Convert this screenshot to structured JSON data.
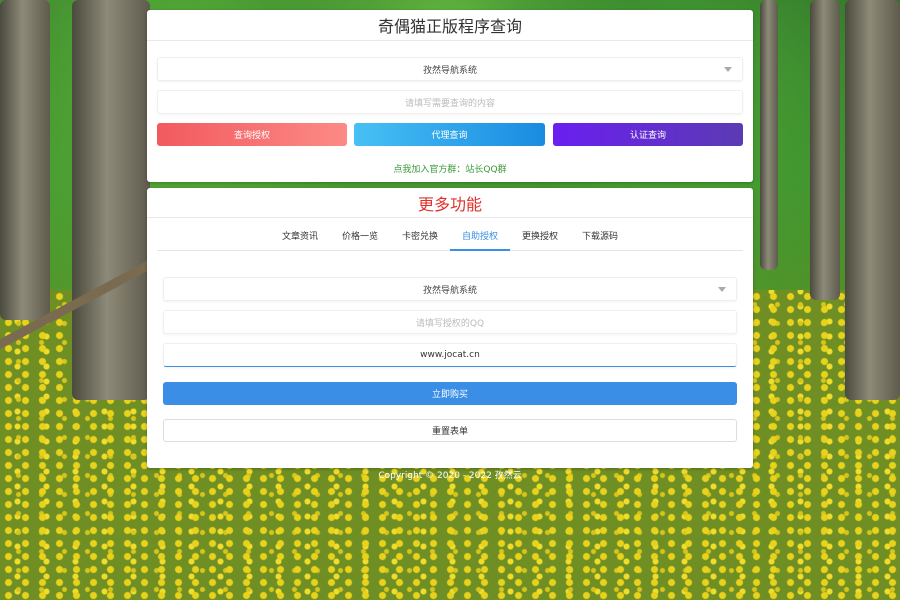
{
  "top_panel": {
    "title": "奇偶猫正版程序查询",
    "system_select": "孜然导航系统",
    "query_placeholder": "请填写需要查询的内容",
    "buttons": {
      "query_auth": "查询授权",
      "agent_query": "代理查询",
      "cert_query": "认证查询"
    },
    "join_text": "点我加入官方群：站长QQ群"
  },
  "bottom_panel": {
    "title": "更多功能",
    "tabs": [
      "文章资讯",
      "价格一览",
      "卡密兑换",
      "自助授权",
      "更换授权",
      "下载源码"
    ],
    "active_tab": "自助授权",
    "system_select": "孜然导航系统",
    "qq_placeholder": "请填写授权的QQ",
    "domain_value": "www.jocat.cn",
    "buy_label": "立即购买",
    "reset_label": "重置表单"
  },
  "footer": {
    "copyright": "Copyright © 2020 - 2022 孜然云"
  },
  "colors": {
    "title_red": "#e0302a",
    "accent_blue": "#3a8ee6",
    "join_green": "#3a9a3a"
  },
  "icons": {
    "select_caret": "chevron-down-icon"
  }
}
